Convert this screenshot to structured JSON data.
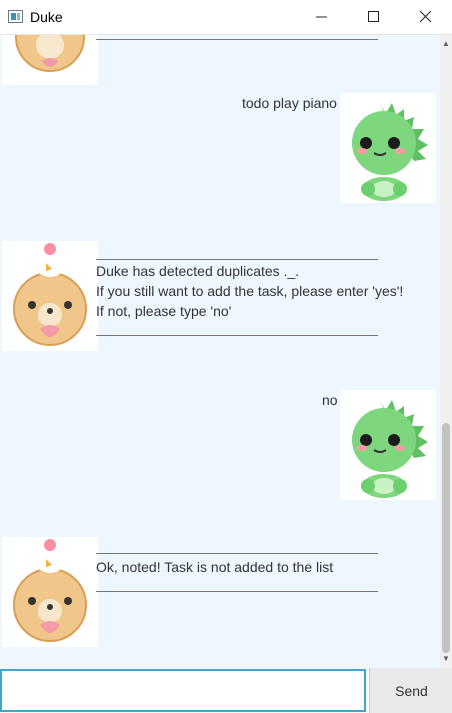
{
  "window": {
    "title": "Duke"
  },
  "chat": {
    "messages": [
      {
        "sender": "user",
        "text": "todo play piano"
      },
      {
        "sender": "duke",
        "lines": [
          "Duke has detected duplicates ._.",
          "If you still want to add the task, please enter 'yes'!",
          "If not, please type 'no'"
        ]
      },
      {
        "sender": "user",
        "text": "no"
      },
      {
        "sender": "duke",
        "lines": [
          "Ok, noted! Task is not added to the list"
        ]
      }
    ]
  },
  "input": {
    "value": "",
    "placeholder": ""
  },
  "send_button": {
    "label": "Send"
  },
  "colors": {
    "chat_background": "#eef6ff",
    "input_border": "#3fa7c8",
    "dino_green": "#7ed67e"
  }
}
